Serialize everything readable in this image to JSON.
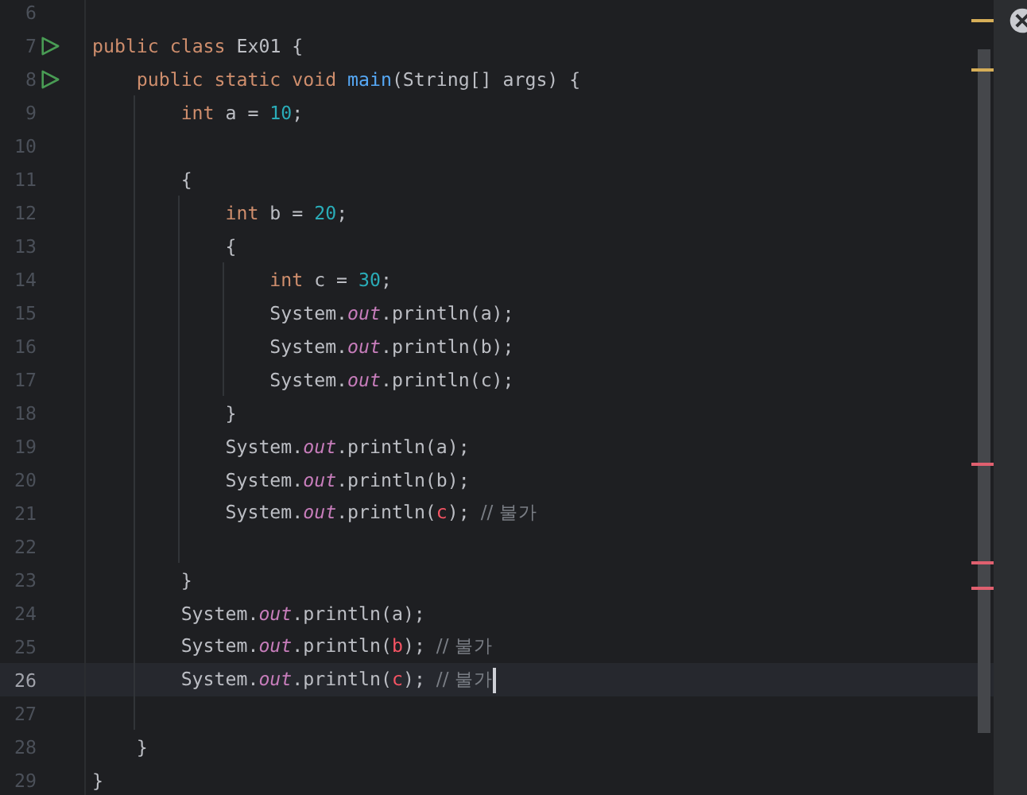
{
  "editor": {
    "lines": [
      {
        "number": "6",
        "runnable": false,
        "current": false
      },
      {
        "number": "7",
        "runnable": true,
        "current": false,
        "tokens": [
          {
            "text": "public class ",
            "kind": "kw"
          },
          {
            "text": "Ex01 {",
            "kind": "plain"
          }
        ]
      },
      {
        "number": "8",
        "runnable": true,
        "current": false,
        "tokens": [
          {
            "text": "    public static void ",
            "kind": "kw"
          },
          {
            "text": "main",
            "kind": "method"
          },
          {
            "text": "(String[] args) {",
            "kind": "plain"
          }
        ]
      },
      {
        "number": "9",
        "runnable": false,
        "current": false,
        "tokens": [
          {
            "text": "        int ",
            "kind": "kw"
          },
          {
            "text": "a = ",
            "kind": "plain"
          },
          {
            "text": "10",
            "kind": "num"
          },
          {
            "text": ";",
            "kind": "plain"
          }
        ]
      },
      {
        "number": "10",
        "runnable": false,
        "current": false
      },
      {
        "number": "11",
        "runnable": false,
        "current": false,
        "tokens": [
          {
            "text": "        {",
            "kind": "plain"
          }
        ]
      },
      {
        "number": "12",
        "runnable": false,
        "current": false,
        "tokens": [
          {
            "text": "            int ",
            "kind": "kw"
          },
          {
            "text": "b = ",
            "kind": "plain"
          },
          {
            "text": "20",
            "kind": "num"
          },
          {
            "text": ";",
            "kind": "plain"
          }
        ]
      },
      {
        "number": "13",
        "runnable": false,
        "current": false,
        "tokens": [
          {
            "text": "            {",
            "kind": "plain"
          }
        ]
      },
      {
        "number": "14",
        "runnable": false,
        "current": false,
        "tokens": [
          {
            "text": "                int ",
            "kind": "kw"
          },
          {
            "text": "c = ",
            "kind": "plain"
          },
          {
            "text": "30",
            "kind": "num"
          },
          {
            "text": ";",
            "kind": "plain"
          }
        ]
      },
      {
        "number": "15",
        "runnable": false,
        "current": false,
        "tokens": [
          {
            "text": "                System.",
            "kind": "plain"
          },
          {
            "text": "out",
            "kind": "field"
          },
          {
            "text": ".println(a);",
            "kind": "plain"
          }
        ]
      },
      {
        "number": "16",
        "runnable": false,
        "current": false,
        "tokens": [
          {
            "text": "                System.",
            "kind": "plain"
          },
          {
            "text": "out",
            "kind": "field"
          },
          {
            "text": ".println(b);",
            "kind": "plain"
          }
        ]
      },
      {
        "number": "17",
        "runnable": false,
        "current": false,
        "tokens": [
          {
            "text": "                System.",
            "kind": "plain"
          },
          {
            "text": "out",
            "kind": "field"
          },
          {
            "text": ".println(c);",
            "kind": "plain"
          }
        ]
      },
      {
        "number": "18",
        "runnable": false,
        "current": false,
        "tokens": [
          {
            "text": "            }",
            "kind": "plain"
          }
        ]
      },
      {
        "number": "19",
        "runnable": false,
        "current": false,
        "tokens": [
          {
            "text": "            System.",
            "kind": "plain"
          },
          {
            "text": "out",
            "kind": "field"
          },
          {
            "text": ".println(a);",
            "kind": "plain"
          }
        ]
      },
      {
        "number": "20",
        "runnable": false,
        "current": false,
        "tokens": [
          {
            "text": "            System.",
            "kind": "plain"
          },
          {
            "text": "out",
            "kind": "field"
          },
          {
            "text": ".println(b);",
            "kind": "plain"
          }
        ]
      },
      {
        "number": "21",
        "runnable": false,
        "current": false,
        "tokens": [
          {
            "text": "            System.",
            "kind": "plain"
          },
          {
            "text": "out",
            "kind": "field"
          },
          {
            "text": ".println(",
            "kind": "plain"
          },
          {
            "text": "c",
            "kind": "err"
          },
          {
            "text": "); ",
            "kind": "plain"
          },
          {
            "text": "// 불가",
            "kind": "comment"
          }
        ]
      },
      {
        "number": "22",
        "runnable": false,
        "current": false
      },
      {
        "number": "23",
        "runnable": false,
        "current": false,
        "tokens": [
          {
            "text": "        }",
            "kind": "plain"
          }
        ]
      },
      {
        "number": "24",
        "runnable": false,
        "current": false,
        "tokens": [
          {
            "text": "        System.",
            "kind": "plain"
          },
          {
            "text": "out",
            "kind": "field"
          },
          {
            "text": ".println(a);",
            "kind": "plain"
          }
        ]
      },
      {
        "number": "25",
        "runnable": false,
        "current": false,
        "tokens": [
          {
            "text": "        System.",
            "kind": "plain"
          },
          {
            "text": "out",
            "kind": "field"
          },
          {
            "text": ".println(",
            "kind": "plain"
          },
          {
            "text": "b",
            "kind": "err"
          },
          {
            "text": "); ",
            "kind": "plain"
          },
          {
            "text": "// 불가",
            "kind": "comment"
          }
        ]
      },
      {
        "number": "26",
        "runnable": false,
        "current": true,
        "tokens": [
          {
            "text": "        System.",
            "kind": "plain"
          },
          {
            "text": "out",
            "kind": "field"
          },
          {
            "text": ".println(",
            "kind": "plain"
          },
          {
            "text": "c",
            "kind": "err"
          },
          {
            "text": "); ",
            "kind": "plain"
          },
          {
            "text": "// 불가",
            "kind": "comment"
          }
        ]
      },
      {
        "number": "27",
        "runnable": false,
        "current": false
      },
      {
        "number": "28",
        "runnable": false,
        "current": false,
        "tokens": [
          {
            "text": "    }",
            "kind": "plain"
          }
        ]
      },
      {
        "number": "29",
        "runnable": false,
        "current": false,
        "tokens": [
          {
            "text": "}",
            "kind": "plain"
          }
        ]
      }
    ]
  }
}
